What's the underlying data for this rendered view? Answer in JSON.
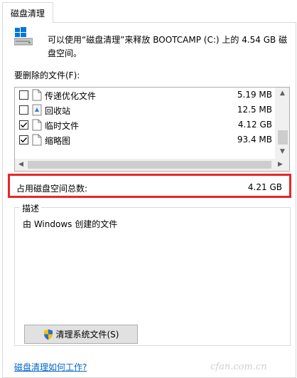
{
  "tab": {
    "label": "磁盘清理"
  },
  "summary": {
    "text": "可以使用“磁盘清理”来释放 BOOTCAMP (C:) 上的 4.54 GB 磁盘空间。"
  },
  "files_label": "要删除的文件(F):",
  "file_list": [
    {
      "name": "传递优化文件",
      "size": "5.19 MB",
      "checked": false,
      "icon": "file-icon"
    },
    {
      "name": "回收站",
      "size": "12.5 MB",
      "checked": false,
      "icon": "recycle-bin-icon"
    },
    {
      "name": "临时文件",
      "size": "4.12 GB",
      "checked": true,
      "icon": "file-icon"
    },
    {
      "name": "缩略图",
      "size": "93.4 MB",
      "checked": true,
      "icon": "file-icon"
    }
  ],
  "total": {
    "label": "占用磁盘空间总数:",
    "value": "4.21 GB"
  },
  "description": {
    "legend": "描述",
    "text": "由 Windows 创建的文件"
  },
  "cleanup_button": {
    "label": "清理系统文件(S)",
    "icon": "uac-shield-icon"
  },
  "help_link": {
    "label": "磁盘清理如何工作?"
  },
  "watermark": {
    "text": "cfan.com.cn"
  },
  "colors": {
    "highlight_border": "#e8262a",
    "link": "#0066cc",
    "button_bg": "#e1e1e1"
  }
}
